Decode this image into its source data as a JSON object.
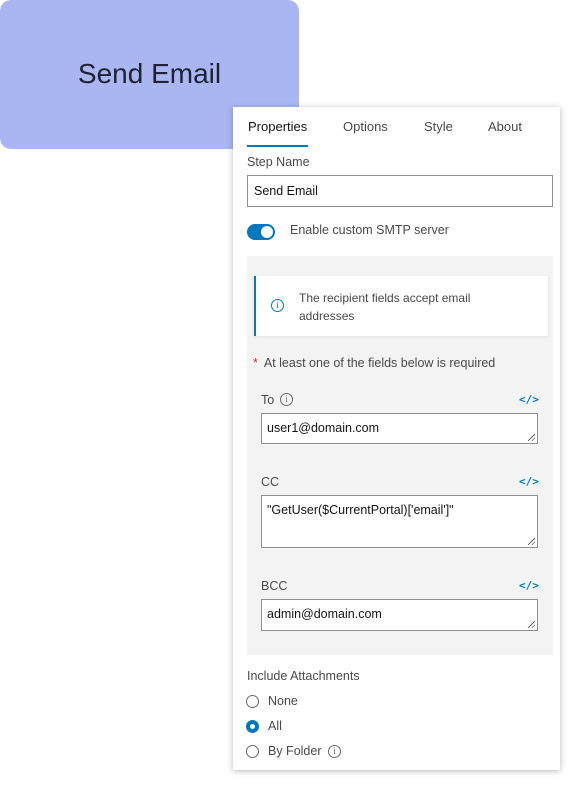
{
  "step_node": {
    "title": "Send Email",
    "color": "#a9b6f1"
  },
  "panel": {
    "tabs": [
      {
        "label": "Properties",
        "active": true
      },
      {
        "label": "Options",
        "active": false
      },
      {
        "label": "Style",
        "active": false
      },
      {
        "label": "About",
        "active": false
      }
    ],
    "step_name": {
      "label": "Step Name",
      "value": "Send Email"
    },
    "smtp_toggle": {
      "label": "Enable custom SMTP server",
      "on": true
    },
    "notice": {
      "icon": "info-icon",
      "text": "The recipient fields accept email addresses"
    },
    "required_note": {
      "star": "*",
      "text": "At least one of the fields below is required"
    },
    "to": {
      "label": "To",
      "value": "user1@domain.com",
      "icon": "info-icon"
    },
    "cc": {
      "label": "CC",
      "value": "\"GetUser($CurrentPortal)['email']\""
    },
    "bcc": {
      "label": "BCC",
      "value": "admin@domain.com"
    },
    "code_icon_glyph": "</>",
    "attachments": {
      "label": "Include Attachments",
      "options": [
        {
          "label": "None",
          "checked": false
        },
        {
          "label": "All",
          "checked": true
        },
        {
          "label": "By Folder",
          "checked": false,
          "info_icon": true
        }
      ]
    }
  },
  "colors": {
    "accent": "#0079c1",
    "required": "#d83020",
    "section_bg": "#f3f3f3"
  }
}
